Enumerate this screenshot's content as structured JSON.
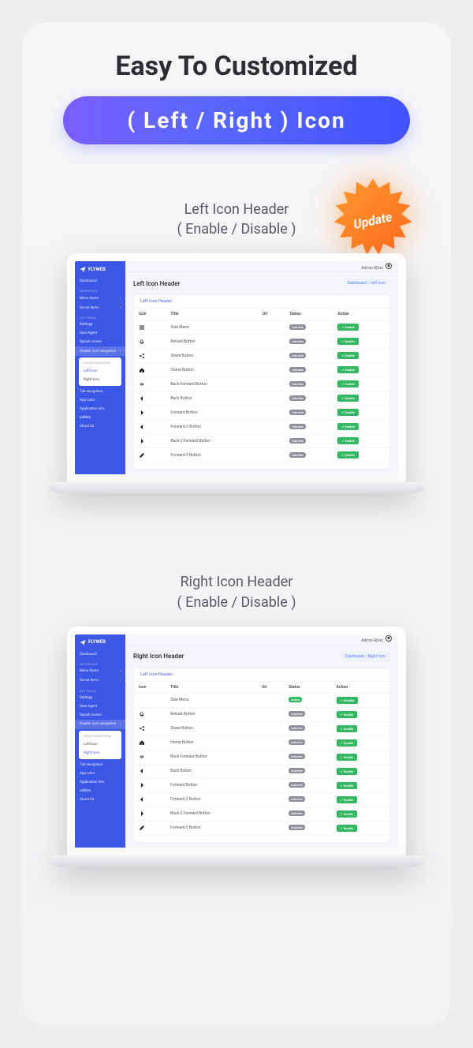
{
  "hero": {
    "title": "Easy To Customized",
    "pill": "( Left / Right ) Icon",
    "starburst": "Update"
  },
  "sections": {
    "left": {
      "heading": "Left Icon Header",
      "sub": "( Enable / Disable )"
    },
    "right": {
      "heading": "Right Icon Header",
      "sub": "( Enable / Disable )"
    }
  },
  "brand": "FLYWEB",
  "topbar": {
    "user": "Admin ADon"
  },
  "breadcrumb": {
    "root": "Dashboard",
    "sep": "/",
    "left": "Left Icon",
    "right": "Right Icon"
  },
  "sidebar": {
    "dashboard": "Dashboard",
    "head_interface": "INTERFACE",
    "menu_items": "Menu Items",
    "social_items": "Social Items",
    "head_settings": "SETTINGS",
    "settings": "Settings",
    "user_agent": "User-Agent",
    "splash": "Splash screen",
    "header_nav": "Header Icon navigation",
    "header_nav_head": "HEADER NAVIGATION",
    "left_icon": "Left Icon",
    "right_icon": "Right Icon",
    "tab_nav": "Tab navigation",
    "app_color": "App color",
    "app_info": "Application info",
    "admob": "adMob",
    "about": "About Us"
  },
  "page_titles": {
    "left": "Left Icon Header",
    "right": "Right Icon Header"
  },
  "panel_title": "Left Icon Header",
  "columns": {
    "icon": "Icon",
    "title": "Title",
    "url": "Url",
    "status": "Status",
    "action": "Action"
  },
  "status": {
    "active": "Active",
    "inactive": "InActive"
  },
  "action": {
    "enable": "Enable",
    "disable": "Disable"
  },
  "left_rows": [
    {
      "icon": "menu",
      "title": "Side Menu",
      "status": "inactive",
      "action": "enable"
    },
    {
      "icon": "reload",
      "title": "Reload Button",
      "status": "inactive",
      "action": "enable"
    },
    {
      "icon": "share",
      "title": "Share Button",
      "status": "inactive",
      "action": "enable"
    },
    {
      "icon": "home",
      "title": "Home Button",
      "status": "inactive",
      "action": "enable"
    },
    {
      "icon": "backfwd",
      "title": "Back Forward Button",
      "status": "inactive",
      "action": "enable"
    },
    {
      "icon": "back",
      "title": "Back Button",
      "status": "inactive",
      "action": "enable"
    },
    {
      "icon": "forward",
      "title": "Forward Button",
      "status": "inactive",
      "action": "enable"
    },
    {
      "icon": "back",
      "title": "Forward-2 Button",
      "status": "inactive",
      "action": "enable"
    },
    {
      "icon": "forward",
      "title": "Back-2 Forward Button",
      "status": "inactive",
      "action": "enable"
    },
    {
      "icon": "edit",
      "title": "Forward-3 Button",
      "status": "inactive",
      "action": "enable"
    }
  ],
  "right_rows": [
    {
      "icon": "blank",
      "title": "Side Menu",
      "status": "active",
      "action": "disable"
    },
    {
      "icon": "reload",
      "title": "Reload Button",
      "status": "inactive",
      "action": "enable"
    },
    {
      "icon": "share",
      "title": "Share Button",
      "status": "inactive",
      "action": "enable"
    },
    {
      "icon": "home",
      "title": "Home Button",
      "status": "inactive",
      "action": "enable"
    },
    {
      "icon": "backfwd",
      "title": "Back Forward Button",
      "status": "inactive",
      "action": "enable"
    },
    {
      "icon": "back",
      "title": "Back Button",
      "status": "inactive",
      "action": "enable"
    },
    {
      "icon": "forward",
      "title": "Forward Button",
      "status": "inactive",
      "action": "enable"
    },
    {
      "icon": "back",
      "title": "Forward-2 Button",
      "status": "inactive",
      "action": "enable"
    },
    {
      "icon": "forward",
      "title": "Back-2 Forward Button",
      "status": "inactive",
      "action": "enable"
    },
    {
      "icon": "edit",
      "title": "Forward-3 Button",
      "status": "inactive",
      "action": "enable"
    }
  ]
}
